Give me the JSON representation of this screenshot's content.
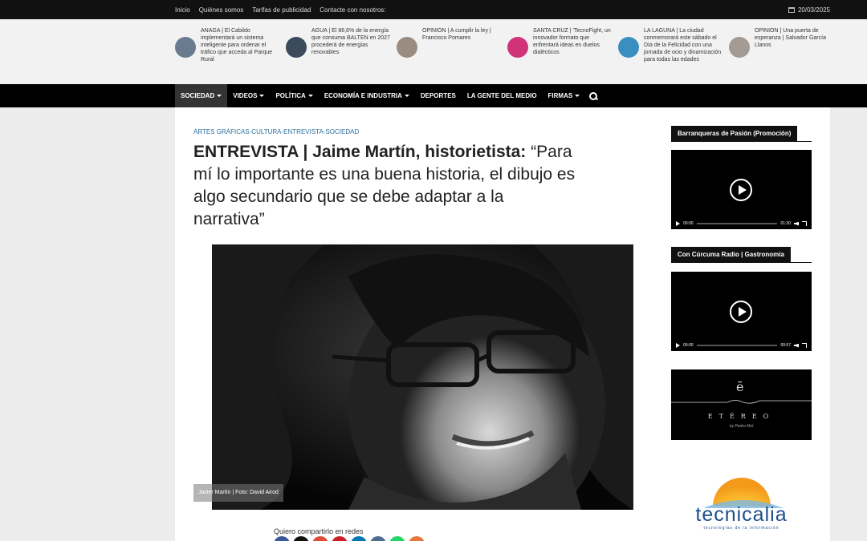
{
  "topbar": {
    "links": [
      "Inicio",
      "Quiénes somos",
      "Tarifas de publicidad",
      "Contacte con nosotros:"
    ],
    "date": "20/03/2025"
  },
  "ticker": [
    {
      "text": "ANAGA | El Cabildo implementará un sistema inteligente para ordenar el tráfico que acceda al Parque Rural",
      "color": "#6a7b8f"
    },
    {
      "text": "AGUA | El 86,6% de la energía que consuma BALTEN en 2027 procederá de energías renovables",
      "color": "#3b4a5c"
    },
    {
      "text": "OPINIÓN | A cumplir la ley | Francisco Pomares",
      "color": "#9a8c80"
    },
    {
      "text": "SANTA CRUZ | 'TecnoFight, un innovador formato que enfrentará ideas en duelos dialécticos",
      "color": "#d0337a"
    },
    {
      "text": "LA LAGUNA | La ciudad conmemorará este sábado el Día de la Felicidad con una jornada de ocio y dinamización para todas las edades",
      "color": "#3a8fc0"
    },
    {
      "text": "OPINIÓN | Una puerta de esperanza | Salvador García Llanos",
      "color": "#a39a94"
    }
  ],
  "nav": {
    "items": [
      {
        "label": "SOCIEDAD",
        "caret": true
      },
      {
        "label": "VIDEOS",
        "caret": true
      },
      {
        "label": "POLÍTICA",
        "caret": true
      },
      {
        "label": "ECONOMÍA E INDUSTRIA",
        "caret": true
      },
      {
        "label": "DEPORTES",
        "caret": false
      },
      {
        "label": "LA GENTE DEL MEDIO",
        "caret": false
      },
      {
        "label": "FIRMAS",
        "caret": true
      }
    ]
  },
  "article": {
    "categories": "ARTES GRÁFICAS-CULTURA-ENTREVISTA-SOCIEDAD",
    "title_main": "ENTREVISTA | Jaime Martín, historietista:",
    "title_sub": "“Para mí lo importante es una buena historia, el dibujo es algo secundario que se debe adaptar a la narrativa”",
    "caption": "Javier Martín | Foto: David Airod",
    "share_label": "Quiero compartirlo en redes",
    "share_colors": [
      "#3b5998",
      "#111111",
      "#dd4b39",
      "#cb2027",
      "#0077b5",
      "#4f6d8f",
      "#25d366",
      "#e2793a"
    ]
  },
  "sidebar": {
    "widget1": {
      "title": "Barranqueras de Pasión (Promoción)",
      "time_current": "00:00",
      "time_total": "01:30"
    },
    "widget2": {
      "title": "Con Cúrcuma Radio | Gastronomía",
      "time_current": "00:00",
      "time_total": "00:57"
    },
    "ethereo": {
      "mark": "ē",
      "word": "ETÉREO",
      "sig": "by Pedro Mol"
    },
    "tecnicalia": {
      "name": "tecnicalia",
      "tag": "tecnologías de la información"
    }
  }
}
